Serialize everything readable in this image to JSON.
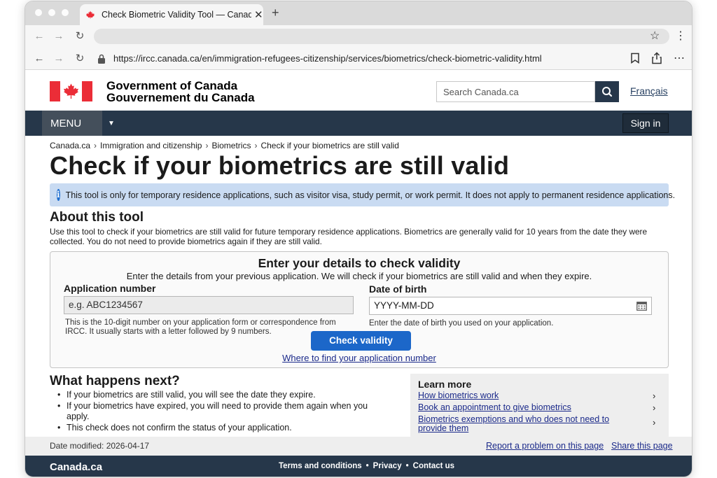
{
  "browser": {
    "tab_title": "Check Biometric Validity Tool — Canada.ca",
    "tab_close": "✕",
    "new_tab": "+",
    "url": "https://ircc.canada.ca/en/immigration-refugees-citizenship/services/biometrics/check-biometric-validity.html"
  },
  "header": {
    "signature_en": "Government of Canada",
    "signature_fr": "Gouvernement du Canada",
    "search_placeholder": "Search Canada.ca",
    "language_link": "Français"
  },
  "menubar": {
    "menu_label": "MENU",
    "sign_in": "Sign in"
  },
  "breadcrumb": [
    "Canada.ca",
    "Immigration and citizenship",
    "Biometrics",
    "Check if your biometrics are still valid"
  ],
  "page_title": "Check if your biometrics are still valid",
  "alert": {
    "icon": "i",
    "text": "This tool is only for temporary residence applications, such as visitor visa, study permit, or work permit. It does not apply to permanent residence applications."
  },
  "about": {
    "heading": "About this tool",
    "text": "Use this tool to check if your biometrics are still valid for future temporary residence applications. Biometrics are generally valid for 10 years from the date they were collected. You do not need to provide biometrics again if they are still valid."
  },
  "form": {
    "title": "Enter your details to check validity",
    "subtitle": "Enter the details from your previous application. We will check if your biometrics are still valid and when they expire.",
    "application_label": "Application number",
    "application_placeholder": "e.g. ABC1234567",
    "application_help": "This is the 10-digit number on your application form or correspondence from IRCC. It usually starts with a letter followed by 9 numbers.",
    "dob_label": "Date of birth",
    "dob_placeholder": "YYYY-MM-DD",
    "dob_help": "Enter the date of birth you used on your application.",
    "submit": "Check validity",
    "help_link": "Where to find your application number"
  },
  "next": {
    "heading": "What happens next?",
    "items": [
      "If your biometrics are still valid, you will see the date they expire.",
      "If your biometrics have expired, you will need to provide them again when you apply.",
      "This check does not confirm the status of your application."
    ]
  },
  "learn_more": {
    "title": "Learn more",
    "links": [
      "How biometrics work",
      "Book an appointment to give biometrics",
      "Biometrics exemptions and who does not need to provide them"
    ]
  },
  "date_modified": "Date modified: 2026-04-17",
  "page_actions": {
    "report": "Report a problem on this page",
    "share": "Share this page"
  },
  "footer": {
    "brand": "Canada.ca",
    "links": [
      "Terms and conditions",
      "Privacy",
      "Contact us"
    ]
  },
  "colors": {
    "gc_blue": "#26374a",
    "alert_bg": "#c9dbf2",
    "button_blue": "#1c67c9",
    "link": "#1b2a8a",
    "flag_red": "#eb2d37"
  }
}
